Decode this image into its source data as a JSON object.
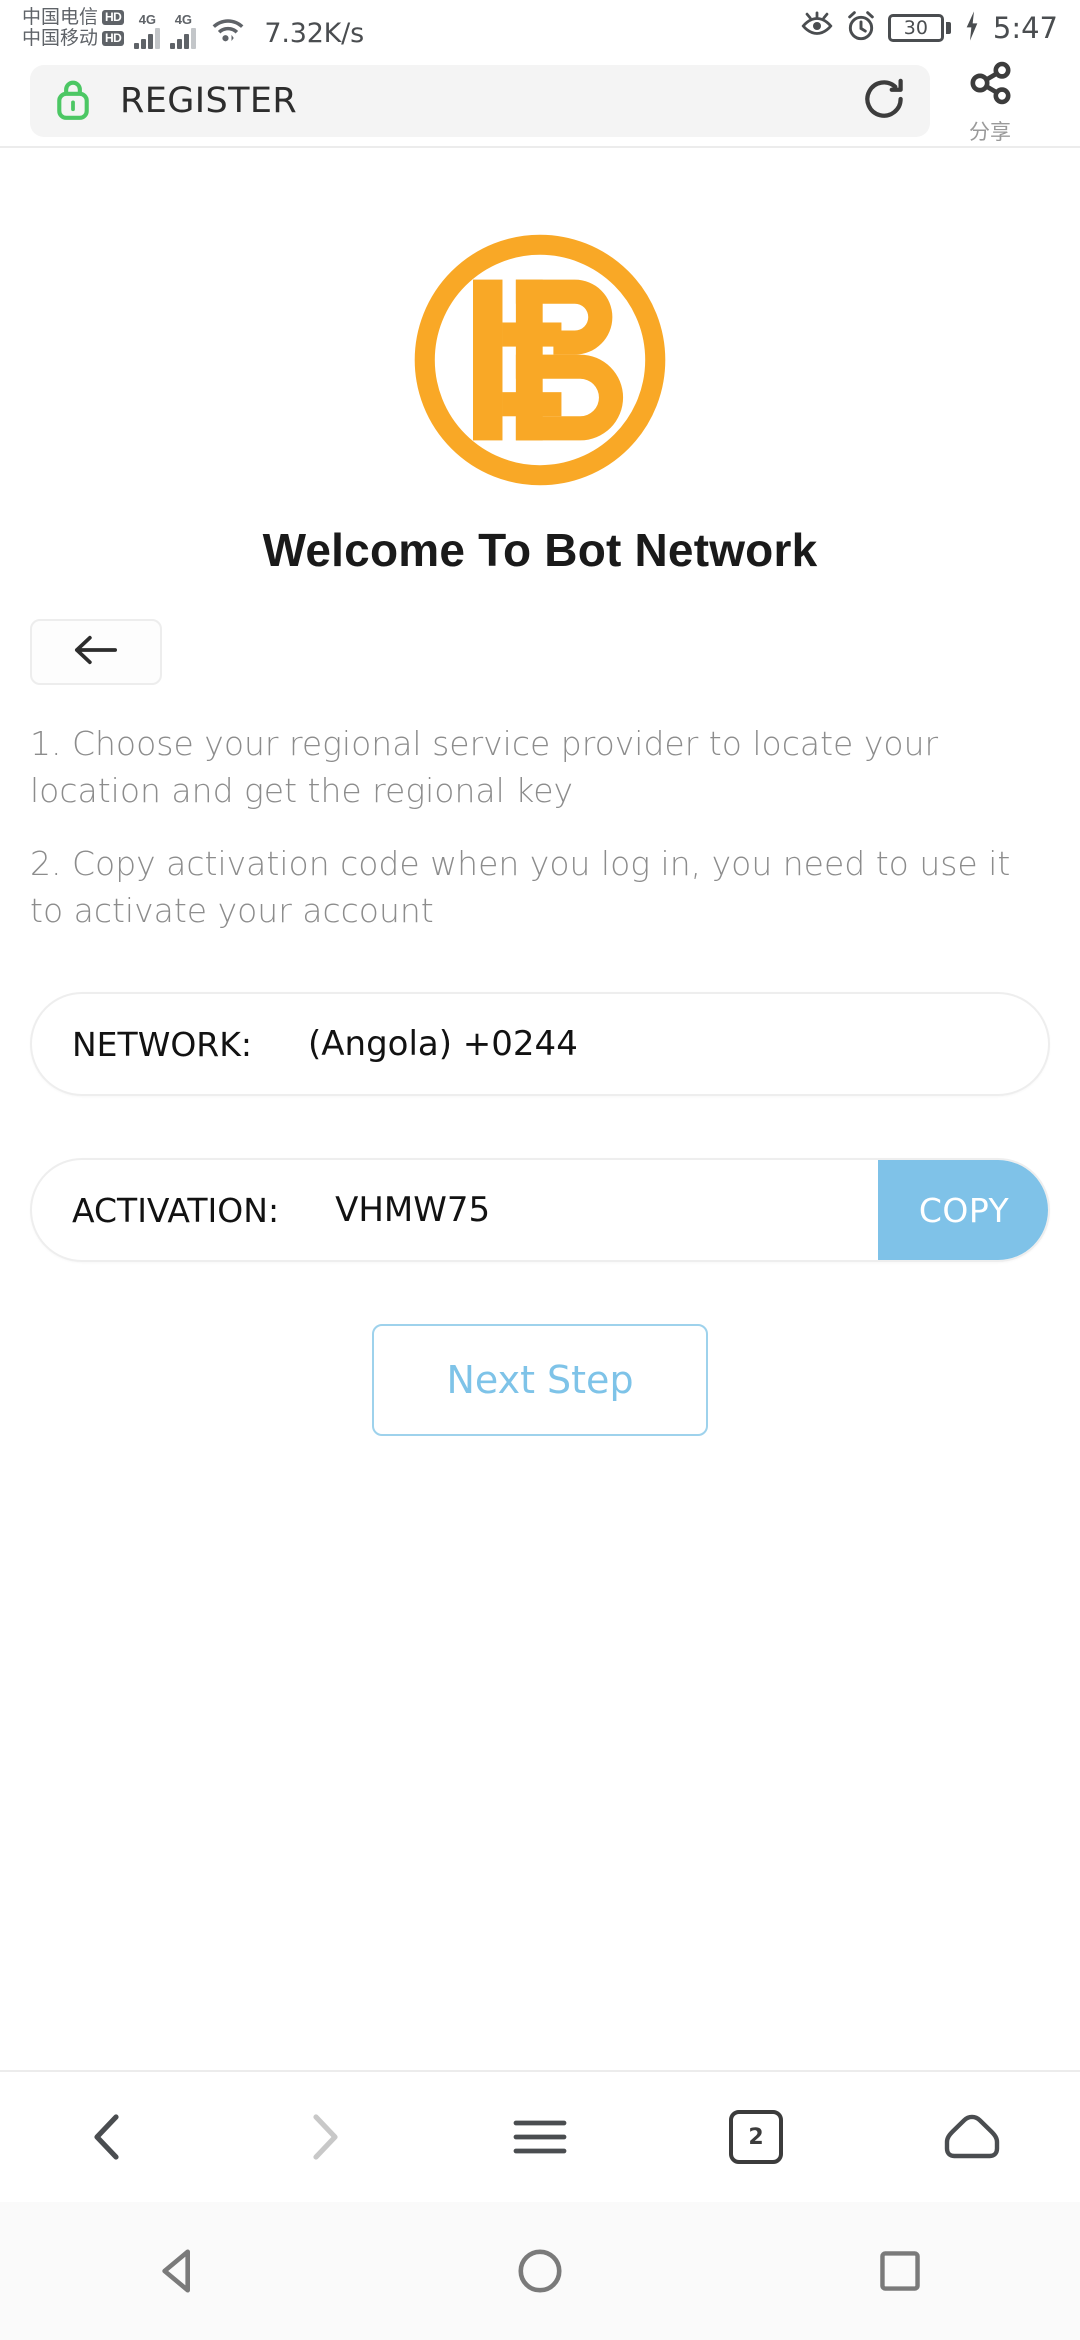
{
  "status_bar": {
    "carriers": [
      {
        "name": "中国电信",
        "badge": "HD"
      },
      {
        "name": "中国移动",
        "badge": "HD"
      }
    ],
    "network_generation_1": "4G",
    "network_generation_2": "4G",
    "network_speed": "7.32K/s",
    "battery_level": "30",
    "time": "5:47",
    "icons": [
      "eye-comfort-icon",
      "alarm-clock-icon",
      "wifi-icon",
      "battery-icon",
      "charging-bolt-icon"
    ]
  },
  "browser": {
    "page_label": "REGISTER",
    "lock_icon": "padlock-icon",
    "lock_color": "#4CC764",
    "refresh_icon": "refresh-icon",
    "share_icon": "share-icon",
    "share_label": "分享",
    "bottom_nav": {
      "back": "chevron-left-icon",
      "forward": "chevron-right-icon",
      "menu": "hamburger-menu-icon",
      "tabs_count": "2",
      "home": "home-icon"
    }
  },
  "system_nav": {
    "back": "triangle-back-icon",
    "home": "circle-home-icon",
    "recents": "square-recents-icon"
  },
  "page": {
    "logo_name": "bot-network-logo",
    "logo_color": "#F9A826",
    "title": "Welcome To Bot Network",
    "back_button_icon": "arrow-left-icon",
    "instructions": [
      "1. Choose your regional service provider to locate your location and get the regional key",
      "2. Copy activation code when you log in, you need to use it to activate your account"
    ],
    "network_field": {
      "label": "NETWORK:",
      "value": "(Angola) +0244"
    },
    "activation_field": {
      "label": "ACTIVATION:",
      "value": "VHMW75",
      "copy_label": "COPY",
      "copy_color": "#7FC2E8"
    },
    "next_button": {
      "label": "Next Step",
      "accent_color": "#7EC3E8"
    }
  }
}
